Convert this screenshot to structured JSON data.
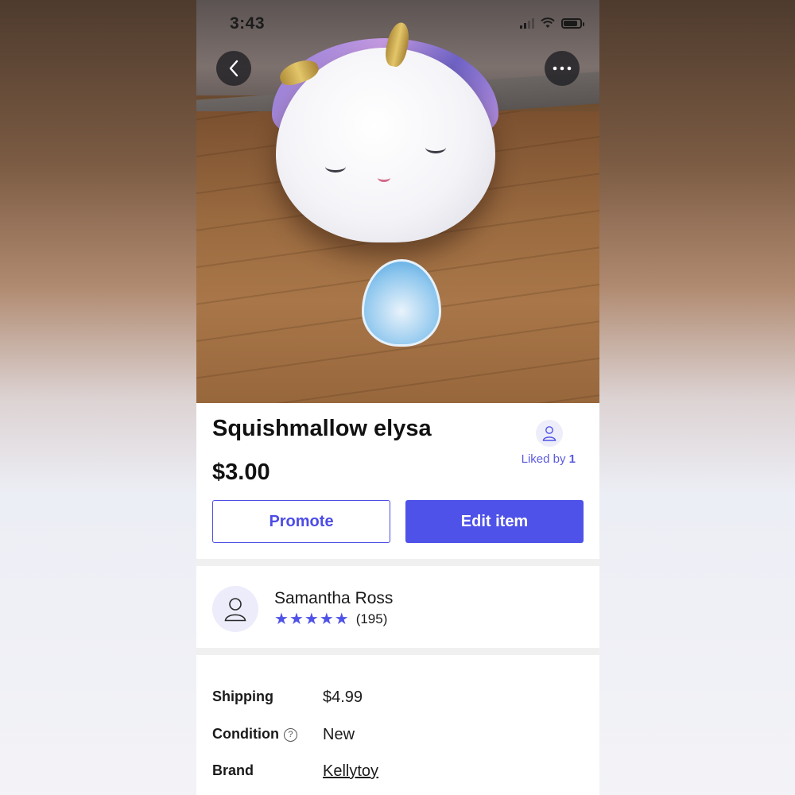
{
  "status_bar": {
    "time": "3:43"
  },
  "listing": {
    "title": "Squishmallow elysa",
    "price": "$3.00",
    "liked_by_label": "Liked by",
    "liked_by_count": "1"
  },
  "actions": {
    "promote_label": "Promote",
    "edit_label": "Edit item"
  },
  "seller": {
    "name": "Samantha Ross",
    "rating_stars": 5,
    "review_count": "(195)"
  },
  "details": {
    "shipping_label": "Shipping",
    "shipping_value": "$4.99",
    "condition_label": "Condition",
    "condition_value": "New",
    "brand_label": "Brand",
    "brand_value": "Kellytoy"
  },
  "icons": {
    "back": "chevron-left-icon",
    "more": "more-horizontal-icon",
    "avatar": "user-icon",
    "help": "question-circle-icon",
    "star": "star-icon"
  },
  "colors": {
    "accent": "#4f52e8",
    "liked_text": "#5a5ae0"
  }
}
